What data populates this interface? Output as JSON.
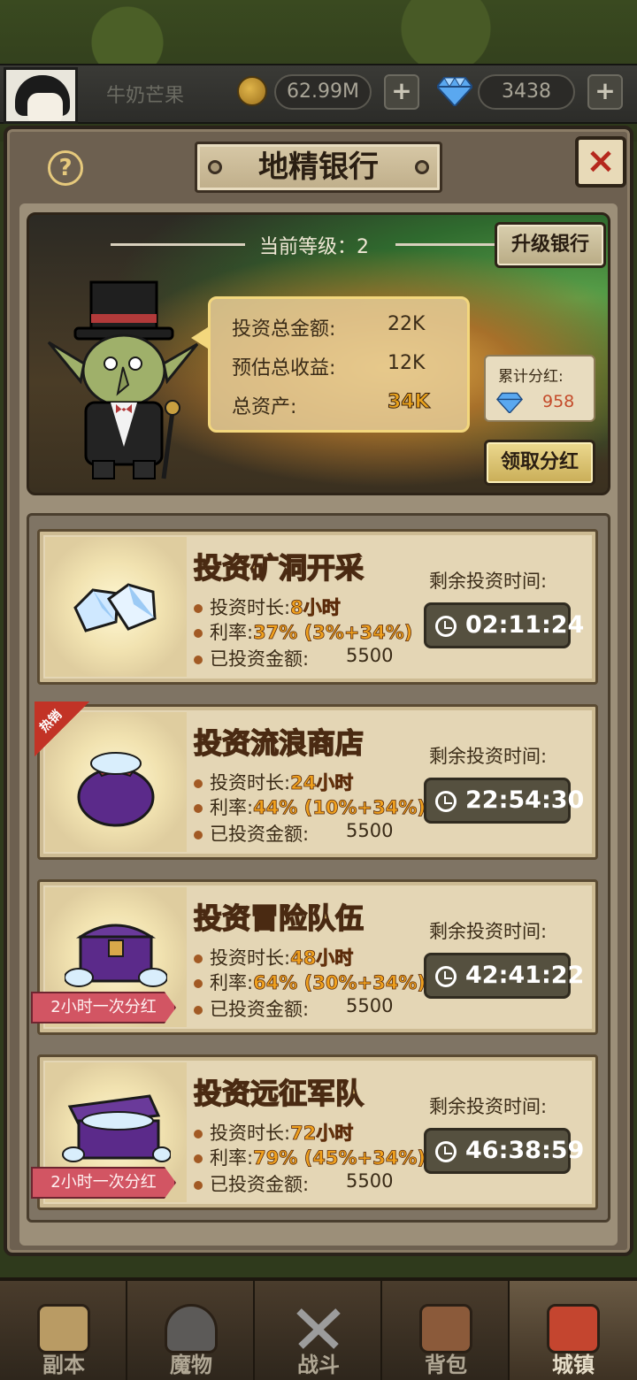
{
  "topbar": {
    "player_name": "牛奶芒果",
    "gold": "62.99M",
    "gems": "3438",
    "plus": "+"
  },
  "dialog": {
    "title": "地精银行",
    "help": "?",
    "close": "×"
  },
  "bank": {
    "level_text": "当前等级：2",
    "upgrade_label": "升级银行",
    "stats": [
      {
        "label": "投资总金额:",
        "value": "22K"
      },
      {
        "label": "预估总收益:",
        "value": "12K"
      },
      {
        "label": "总资产:",
        "value": "34K"
      }
    ],
    "dividend_label": "累计分红:",
    "dividend_value": "958",
    "claim_label": "领取分红"
  },
  "cards": [
    {
      "name": "投资矿洞开采",
      "duration_label": "投资时长:",
      "duration": "8小时",
      "rate_label": "利率:",
      "rate": "37% (3%+34%)",
      "amount_label": "已投资金额:",
      "amount": "5500",
      "remain_label": "剩余投资时间:",
      "timer": "02:11:24",
      "hot": "",
      "dividend_tag": "",
      "icon": "diamond-pile-icon"
    },
    {
      "name": "投资流浪商店",
      "duration_label": "投资时长:",
      "duration": "24小时",
      "rate_label": "利率:",
      "rate": "44% (10%+34%)",
      "amount_label": "已投资金额:",
      "amount": "5500",
      "remain_label": "剩余投资时间:",
      "timer": "22:54:30",
      "hot": "热销",
      "dividend_tag": "",
      "icon": "treasure-bag-icon"
    },
    {
      "name": "投资冒险队伍",
      "duration_label": "投资时长:",
      "duration": "48小时",
      "rate_label": "利率:",
      "rate": "64% (30%+34%)",
      "amount_label": "已投资金额:",
      "amount": "5500",
      "remain_label": "剩余投资时间:",
      "timer": "42:41:22",
      "hot": "",
      "dividend_tag": "2小时一次分红",
      "icon": "treasure-chest-icon"
    },
    {
      "name": "投资远征军队",
      "duration_label": "投资时长:",
      "duration": "72小时",
      "rate_label": "利率:",
      "rate": "79% (45%+34%)",
      "amount_label": "已投资金额:",
      "amount": "5500",
      "remain_label": "剩余投资时间:",
      "timer": "46:38:59",
      "hot": "",
      "dividend_tag": "2小时一次分红",
      "icon": "open-chest-icon"
    }
  ],
  "nav": [
    {
      "label": "副本",
      "icon": "map-icon"
    },
    {
      "label": "魔物",
      "icon": "monster-icon"
    },
    {
      "label": "战斗",
      "icon": "crossed-swords-icon"
    },
    {
      "label": "背包",
      "icon": "backpack-icon"
    },
    {
      "label": "城镇",
      "icon": "town-icon",
      "active": true
    }
  ],
  "colors": {
    "accent_gold": "#e9a21b",
    "close_red": "#b5281d",
    "dividend_tag": "#d25563"
  }
}
